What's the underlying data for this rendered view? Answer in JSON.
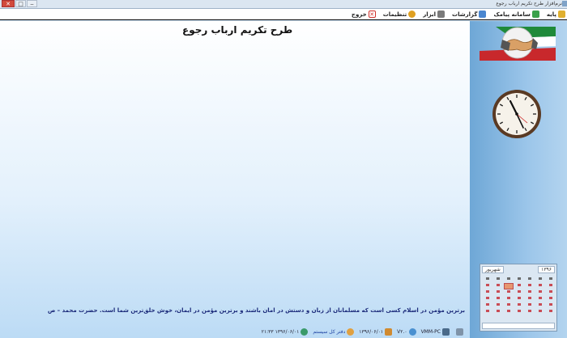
{
  "window": {
    "title": "نرم‌افزار طرح تکریم ارباب رجوع",
    "buttons": {
      "minimize": "‒",
      "maximize": "□",
      "close": "✕"
    }
  },
  "menu": [
    {
      "label": "پایه",
      "icon": "folder-icon",
      "color": "#e0b030"
    },
    {
      "label": "سامانه پیامک",
      "icon": "sms-icon",
      "color": "#3aa14a"
    },
    {
      "label": "گزارشات",
      "icon": "tools-icon",
      "color": "#4a86d0"
    },
    {
      "label": "ابزار",
      "icon": "wrench-icon",
      "color": "#7a7a7a"
    },
    {
      "label": "تنظیمات",
      "icon": "gear-icon",
      "color": "#e0a020"
    },
    {
      "label": "خروج",
      "icon": "exit-icon",
      "color": "#d0302a"
    }
  ],
  "main": {
    "title": "طرح تکریم ارباب رجوع",
    "hadith": "برترین مؤمن در اسلام کسی است که مسلمانان از زبان و دستش در امان باشند و برترین مؤمن در ایمان، خوش خلق‌ترین شما است.  حضرت محمد – ص"
  },
  "calendar": {
    "month": "شهریور",
    "year": "۱۳۹۶"
  },
  "status": [
    {
      "text": "",
      "icon": "window-icon"
    },
    {
      "text": "VMM-PC",
      "icon": "computer-icon"
    },
    {
      "text": "V۲.۰",
      "icon": "version-icon"
    },
    {
      "text": "۱۳۹۶/۰۶/۰۱",
      "icon": "date-icon"
    },
    {
      "text": "دفتر کل سیستم",
      "icon": "user-icon"
    },
    {
      "text": "۱۳۹۶/۰۶/۰۱ ۲۱:۳۳",
      "icon": "globe-icon"
    }
  ],
  "colors": {
    "sidebar": "#7fb3e0",
    "menu_border": "#0a0a0a",
    "hadith": "#1b2a7a"
  }
}
